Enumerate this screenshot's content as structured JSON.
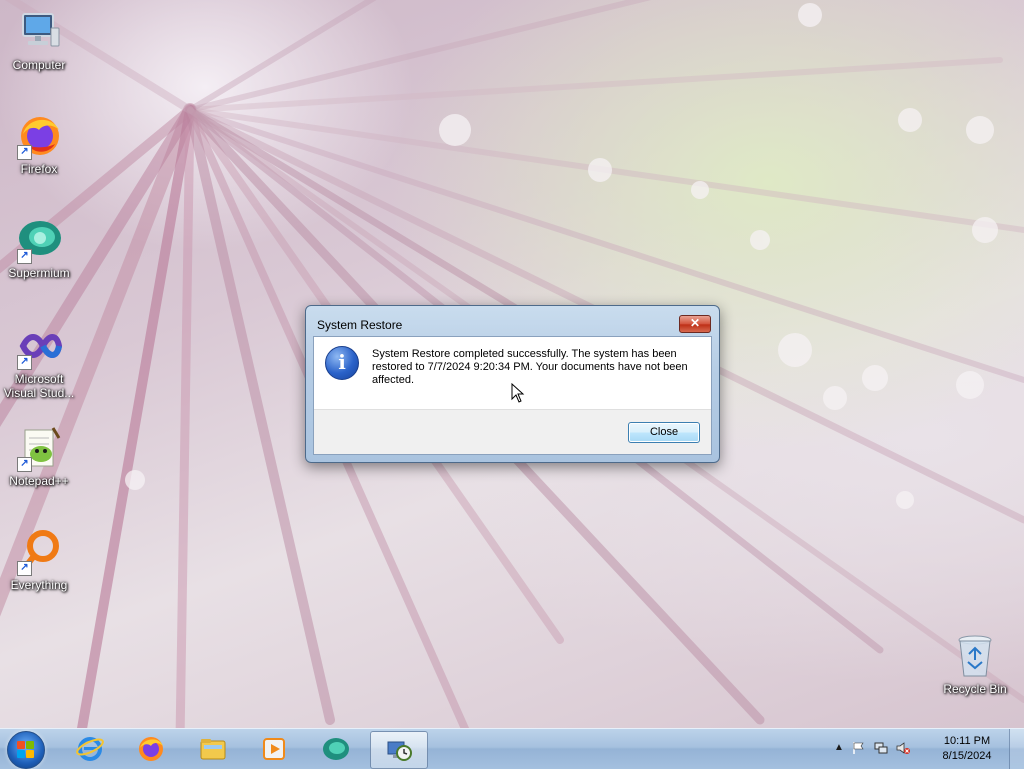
{
  "desktop": {
    "icons": [
      {
        "label": "Computer",
        "icon": "computer-icon",
        "shortcut": false
      },
      {
        "label": "Firefox",
        "icon": "firefox-icon",
        "shortcut": true
      },
      {
        "label": "Supermium",
        "icon": "supermium-icon",
        "shortcut": true
      },
      {
        "label": "Microsoft Visual Stud...",
        "icon": "visual-studio-icon",
        "shortcut": true
      },
      {
        "label": "Notepad++",
        "icon": "notepadpp-icon",
        "shortcut": true
      },
      {
        "label": "Everything",
        "icon": "everything-icon",
        "shortcut": true
      },
      {
        "label": "Recycle Bin",
        "icon": "recycle-bin-icon",
        "shortcut": false
      }
    ]
  },
  "dialog": {
    "title": "System Restore",
    "close_glyph": "✕",
    "info_glyph": "i",
    "message": "System Restore completed successfully. The system has been restored to 7/7/2024 9:20:34 PM. Your documents have not been affected.",
    "close_button": "Close"
  },
  "taskbar": {
    "pinned": [
      {
        "name": "internet-explorer",
        "icon": "internet-explorer-icon"
      },
      {
        "name": "firefox",
        "icon": "firefox-icon"
      },
      {
        "name": "file-explorer",
        "icon": "folder-icon"
      },
      {
        "name": "media-player",
        "icon": "media-player-icon"
      },
      {
        "name": "supermium",
        "icon": "supermium-icon"
      },
      {
        "name": "system-restore",
        "icon": "system-restore-icon",
        "active": true
      }
    ],
    "tray": {
      "show_hidden_glyph": "▲",
      "time": "10:11 PM",
      "date": "8/15/2024"
    }
  },
  "colors": {
    "dialog_frame": "#b6cde5",
    "taskbar": "#a6c1df",
    "button_border": "#3c7fb1",
    "close_red": "#d3533c"
  }
}
